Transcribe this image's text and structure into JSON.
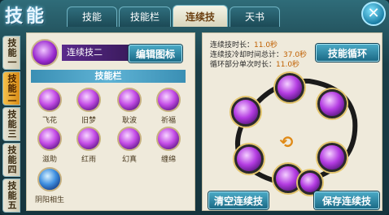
{
  "window": {
    "title": "技能"
  },
  "tabs": [
    {
      "label": "技能"
    },
    {
      "label": "技能栏"
    },
    {
      "label": "连续技"
    },
    {
      "label": "天书"
    }
  ],
  "side_tabs": [
    {
      "label": "技能一"
    },
    {
      "label": "技能二"
    },
    {
      "label": "技能三"
    },
    {
      "label": "技能四"
    },
    {
      "label": "技能五"
    }
  ],
  "combo_header": {
    "label": "连续技二",
    "edit_icon_button": "编辑图标"
  },
  "skill_bar": {
    "title": "技能栏",
    "skills": [
      {
        "label": "飞花",
        "color": "purple"
      },
      {
        "label": "旧梦",
        "color": "purple"
      },
      {
        "label": "耿波",
        "color": "purple"
      },
      {
        "label": "祈福",
        "color": "purple"
      },
      {
        "label": "滋助",
        "color": "purple"
      },
      {
        "label": "红雨",
        "color": "purple"
      },
      {
        "label": "幻真",
        "color": "purple"
      },
      {
        "label": "缠绵",
        "color": "purple"
      },
      {
        "label": "阴阳相生",
        "color": "blue"
      }
    ]
  },
  "stats": [
    {
      "label": "连续技时长：",
      "value": "11.0秒"
    },
    {
      "label": "连续技冷却时间总计：",
      "value": "37.0秒"
    },
    {
      "label": "循环部分单次时长：",
      "value": "11.0秒"
    }
  ],
  "buttons": {
    "skill_cycle": "技能循环",
    "clear_combo": "清空连续技",
    "save_combo": "保存连续技"
  },
  "combo_slots": 7,
  "colors": {
    "accent": "#1b6a86",
    "active_tab": "#d88c17"
  }
}
